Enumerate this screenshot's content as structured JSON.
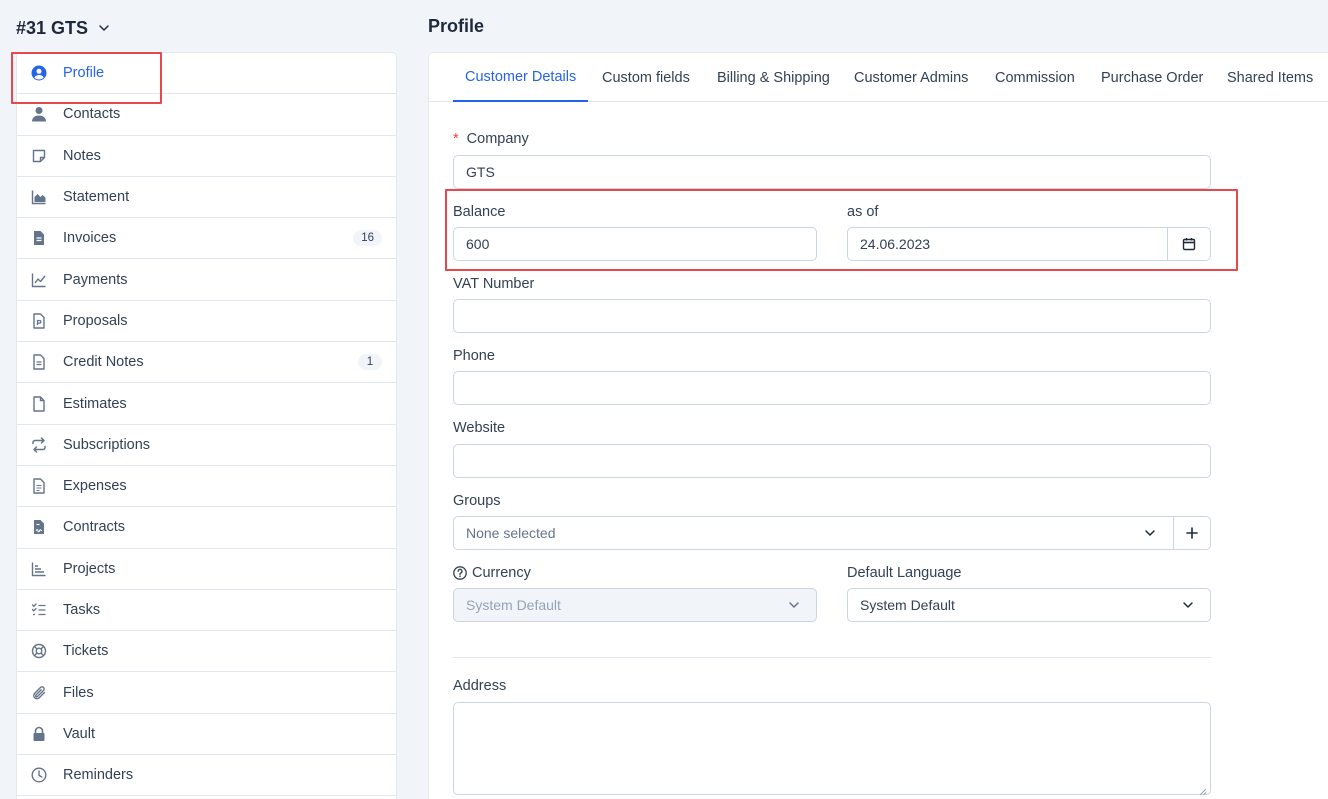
{
  "client": {
    "title": "#31 GTS"
  },
  "sidebar": {
    "items": [
      {
        "label": "Profile",
        "icon": "user-circle-icon",
        "active": true
      },
      {
        "label": "Contacts",
        "icon": "user-icon"
      },
      {
        "label": "Notes",
        "icon": "sticky-note-icon"
      },
      {
        "label": "Statement",
        "icon": "area-chart-icon"
      },
      {
        "label": "Invoices",
        "icon": "document-icon",
        "badge": "16"
      },
      {
        "label": "Payments",
        "icon": "line-chart-icon"
      },
      {
        "label": "Proposals",
        "icon": "proposal-icon"
      },
      {
        "label": "Credit Notes",
        "icon": "document-text-icon",
        "badge": "1"
      },
      {
        "label": "Estimates",
        "icon": "file-icon"
      },
      {
        "label": "Subscriptions",
        "icon": "repeat-icon"
      },
      {
        "label": "Expenses",
        "icon": "file-lines-icon"
      },
      {
        "label": "Contracts",
        "icon": "contract-icon"
      },
      {
        "label": "Projects",
        "icon": "bar-chart-icon"
      },
      {
        "label": "Tasks",
        "icon": "checklist-icon"
      },
      {
        "label": "Tickets",
        "icon": "lifebuoy-icon"
      },
      {
        "label": "Files",
        "icon": "paperclip-icon"
      },
      {
        "label": "Vault",
        "icon": "lock-icon"
      },
      {
        "label": "Reminders",
        "icon": "clock-icon"
      }
    ]
  },
  "main": {
    "title": "Profile",
    "tabs": [
      {
        "label": "Customer Details",
        "active": true
      },
      {
        "label": "Custom fields"
      },
      {
        "label": "Billing & Shipping"
      },
      {
        "label": "Customer Admins"
      },
      {
        "label": "Commission"
      },
      {
        "label": "Purchase Order"
      },
      {
        "label": "Shared Items"
      }
    ],
    "form": {
      "company_required_mark": "*",
      "company_label": "Company",
      "company_value": "GTS",
      "balance_label": "Balance",
      "balance_value": "600",
      "as_of_label": "as of",
      "as_of_value": "24.06.2023",
      "vat_label": "VAT Number",
      "vat_value": "",
      "phone_label": "Phone",
      "phone_value": "",
      "website_label": "Website",
      "website_value": "",
      "groups_label": "Groups",
      "groups_placeholder": "None selected",
      "currency_label": "Currency",
      "currency_value": "System Default",
      "language_label": "Default Language",
      "language_value": "System Default",
      "address_label": "Address",
      "address_value": ""
    }
  },
  "colors": {
    "accent": "#2563eb",
    "highlight_box": "#e5484d"
  }
}
